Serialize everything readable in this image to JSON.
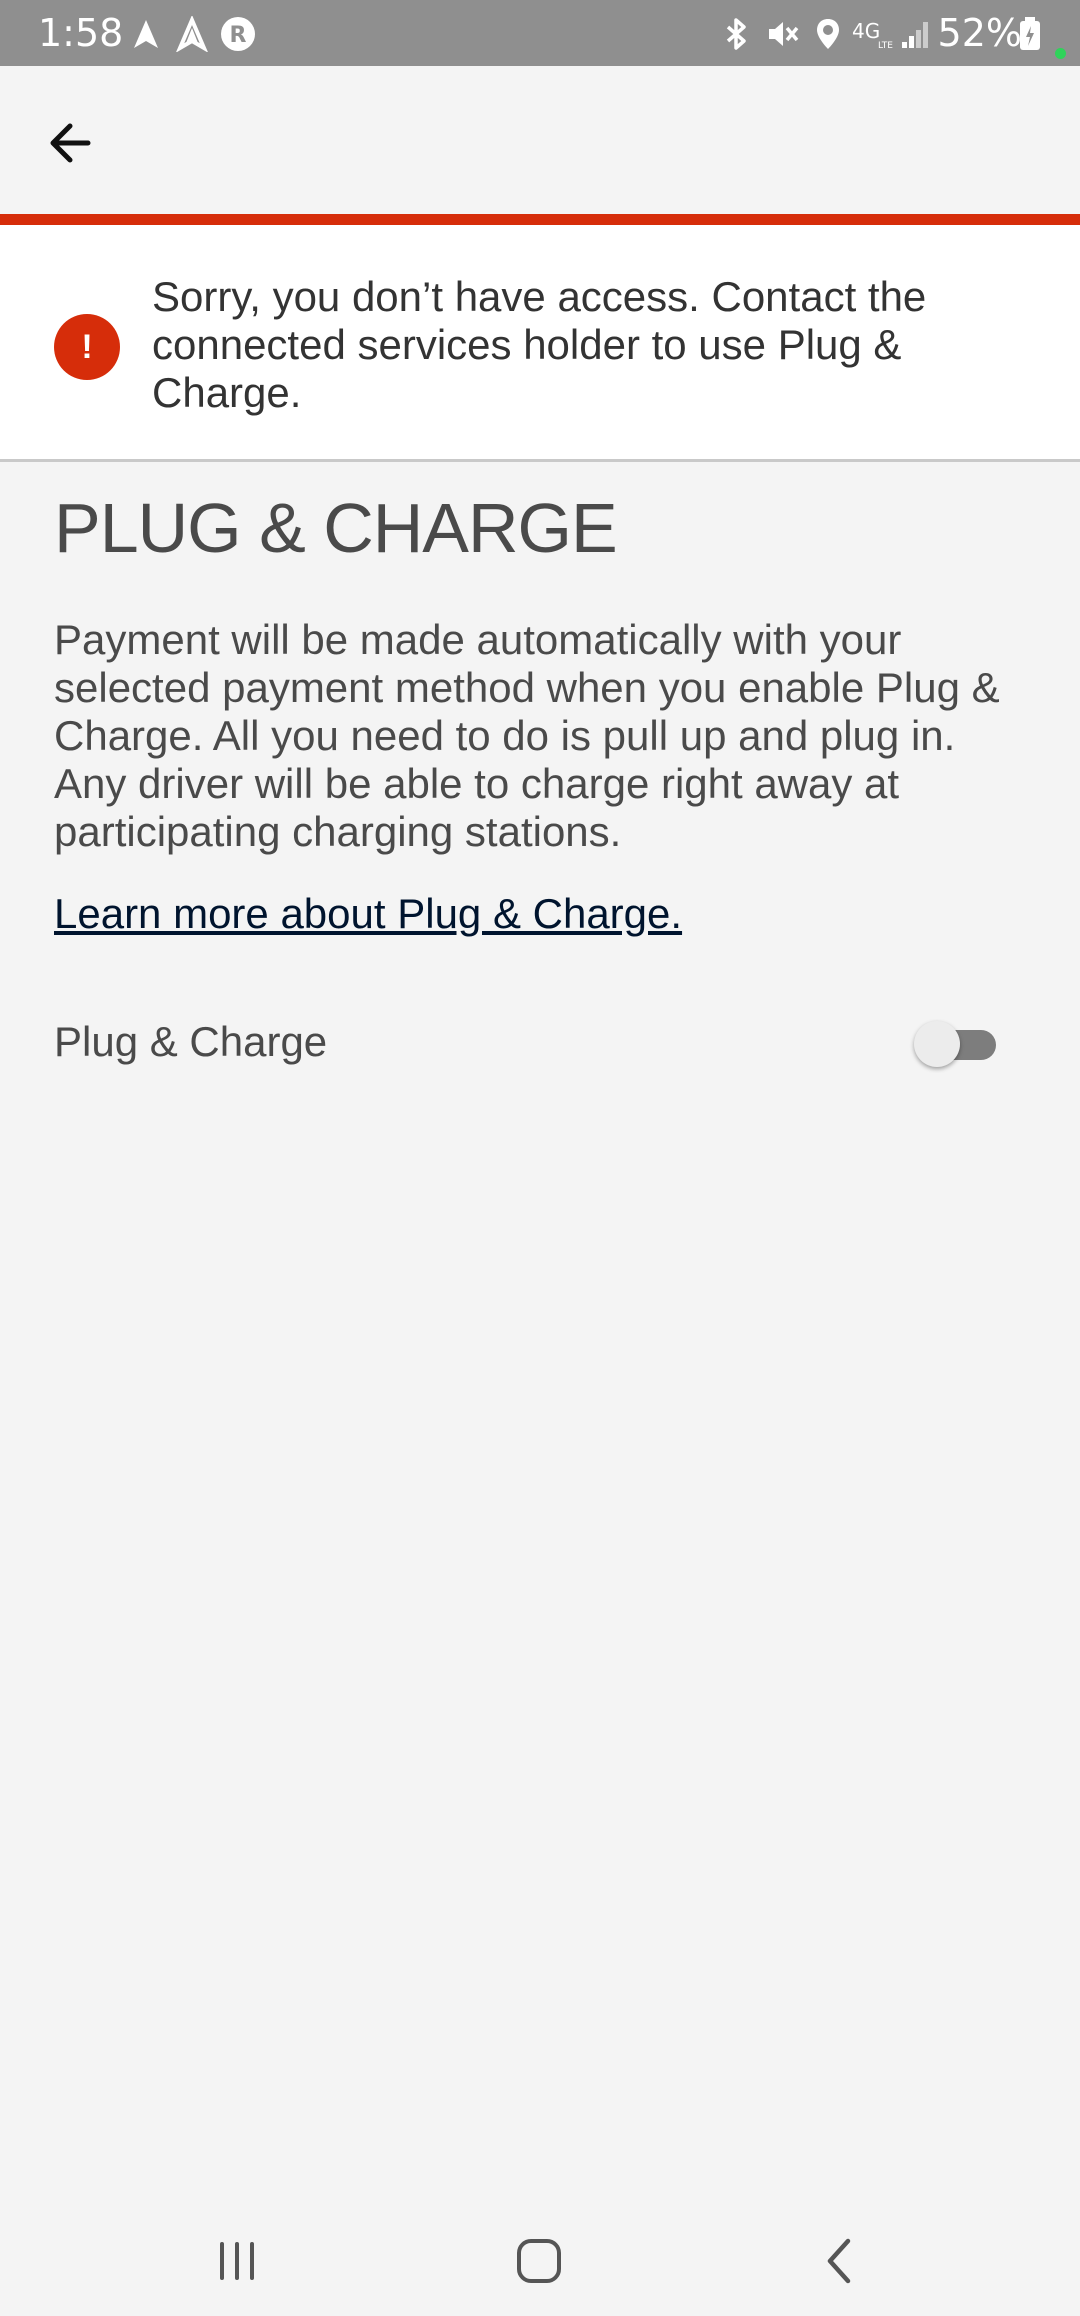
{
  "status_bar": {
    "time": "1:58",
    "battery": "52%",
    "icons": [
      "navigation-arrow-icon",
      "navigation-outline-icon",
      "r-app-icon",
      "bluetooth-icon",
      "mute-icon",
      "location-icon",
      "4g-lte-icon",
      "signal-icon",
      "battery-icon"
    ]
  },
  "app_bar": {
    "back_icon": "arrow-left-icon"
  },
  "alert": {
    "icon": "!",
    "message": "Sorry, you don’t have access. Contact the connected services holder to use Plug & Charge.",
    "color": "#d62d0a"
  },
  "page": {
    "title": "PLUG & CHARGE",
    "description": "Payment will be made automatically with your selected payment method when you enable Plug & Charge. All you need to do is pull up and plug in. Any driver will be able to charge right away at participating charging stations.",
    "learn_more": "Learn more about Plug & Charge.",
    "toggle_label": "Plug & Charge",
    "toggle_on": false
  },
  "nav_bar": {
    "buttons": [
      "recent-apps-icon",
      "home-icon",
      "back-icon"
    ]
  },
  "colors": {
    "accent": "#d62d0a",
    "background": "#f4f4f4",
    "link": "#00142e"
  }
}
